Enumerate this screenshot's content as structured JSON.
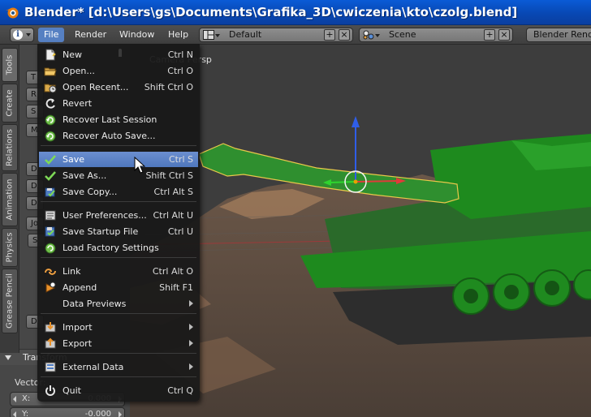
{
  "window": {
    "title": "Blender* [d:\\Users\\gs\\Documents\\Grafika_3D\\cwiczenia\\kto\\czolg.blend]"
  },
  "menubar": {
    "items": [
      "File",
      "Render",
      "Window",
      "Help"
    ],
    "active": "File",
    "layout": "Default",
    "scene": "Scene",
    "render_engine": "Blender Render"
  },
  "toolshelf": {
    "tabs": [
      "Tools",
      "Create",
      "Relations",
      "Animation",
      "Physics",
      "Grease Pencil"
    ],
    "panel_title": "Transform",
    "vector_label": "Vector:",
    "fields": [
      {
        "label": "X:",
        "value": "0.000"
      },
      {
        "label": "Y:",
        "value": "-0.000"
      }
    ]
  },
  "viewport": {
    "camera_label": "Camera Persp"
  },
  "file_menu": {
    "items": [
      {
        "label": "New",
        "shortcut": "Ctrl N",
        "icon": "new-file-icon"
      },
      {
        "label": "Open...",
        "shortcut": "Ctrl O",
        "icon": "folder-icon"
      },
      {
        "label": "Open Recent...",
        "shortcut": "Shift Ctrl O",
        "icon": "open-recent-icon"
      },
      {
        "label": "Revert",
        "shortcut": "",
        "icon": "revert-icon"
      },
      {
        "label": "Recover Last Session",
        "shortcut": "",
        "icon": "recover-icon"
      },
      {
        "label": "Recover Auto Save...",
        "shortcut": "",
        "icon": "recover-icon"
      },
      {
        "label": "Save",
        "shortcut": "Ctrl S",
        "icon": "checkmark-icon",
        "highlighted": true
      },
      {
        "label": "Save As...",
        "shortcut": "Shift Ctrl S",
        "icon": "checkmark-icon"
      },
      {
        "label": "Save Copy...",
        "shortcut": "Ctrl Alt S",
        "icon": "save-copy-icon"
      },
      {
        "label": "User Preferences...",
        "shortcut": "Ctrl Alt U",
        "icon": "preferences-icon"
      },
      {
        "label": "Save Startup File",
        "shortcut": "Ctrl U",
        "icon": "save-startup-icon"
      },
      {
        "label": "Load Factory Settings",
        "shortcut": "",
        "icon": "load-factory-icon"
      },
      {
        "label": "Link",
        "shortcut": "Ctrl Alt O",
        "icon": "link-icon"
      },
      {
        "label": "Append",
        "shortcut": "Shift F1",
        "icon": "append-icon"
      },
      {
        "label": "Data Previews",
        "shortcut": "",
        "icon": "",
        "submenu": true
      },
      {
        "label": "Import",
        "shortcut": "",
        "icon": "import-icon",
        "submenu": true
      },
      {
        "label": "Export",
        "shortcut": "",
        "icon": "export-icon",
        "submenu": true
      },
      {
        "label": "External Data",
        "shortcut": "",
        "icon": "external-data-icon",
        "submenu": true
      },
      {
        "label": "Quit",
        "shortcut": "Ctrl Q",
        "icon": "power-icon"
      }
    ]
  },
  "colors": {
    "menu_highlight": "#5b82c6",
    "tank_green": "#1f7a1f",
    "ground": "#8b6a4e"
  }
}
